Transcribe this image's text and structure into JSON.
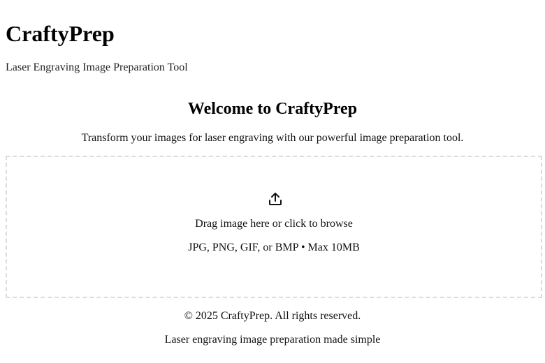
{
  "header": {
    "title": "CraftyPrep",
    "subtitle": "Laser Engraving Image Preparation Tool"
  },
  "welcome": {
    "heading": "Welcome to CraftyPrep",
    "description": "Transform your images for laser engraving with our powerful image preparation tool."
  },
  "dropzone": {
    "icon": "upload-icon",
    "main_text": "Drag image here or click to browse",
    "hint_text": "JPG, PNG, GIF, or BMP • Max 10MB"
  },
  "footer": {
    "copyright": "© 2025 CraftyPrep. All rights reserved.",
    "tagline": "Laser engraving image preparation made simple"
  }
}
